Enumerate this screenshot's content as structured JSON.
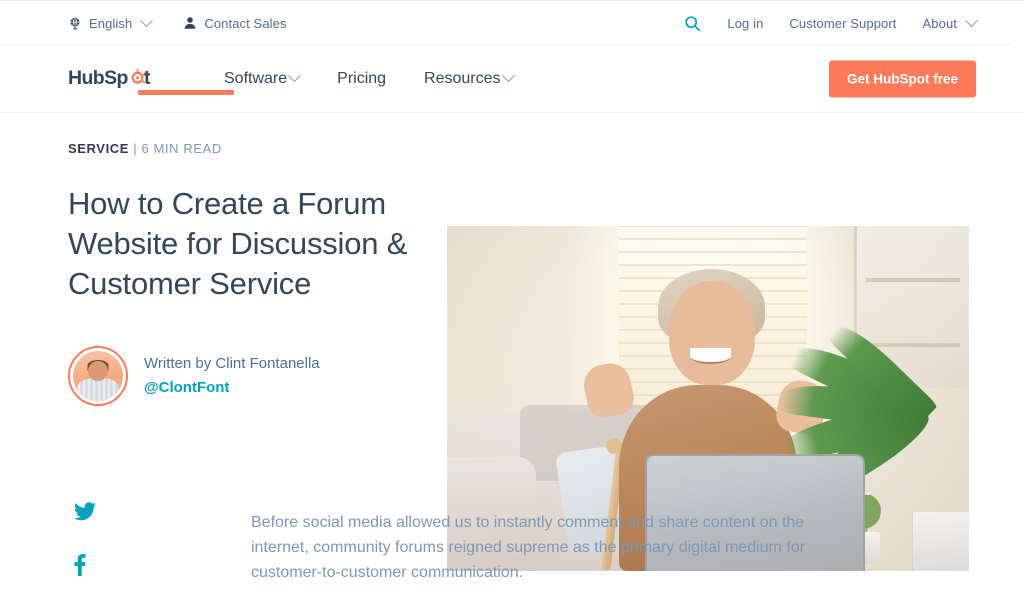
{
  "utility_bar": {
    "language": {
      "icon": "globe-icon",
      "label": "English",
      "chevron": "chevron-down-icon"
    },
    "contact": {
      "icon": "person-icon",
      "label": "Contact Sales"
    },
    "search": {
      "icon": "search-icon"
    },
    "login": {
      "label": "Log in"
    },
    "support": {
      "label": "Customer Support"
    },
    "about": {
      "label": "About",
      "chevron": "chevron-down-icon"
    }
  },
  "main_nav": {
    "logo": {
      "name": "hubspot-logo",
      "text_part1": "HubSp",
      "text_part2": "t"
    },
    "links": [
      {
        "label": "Software",
        "has_chevron": true
      },
      {
        "label": "Pricing",
        "has_chevron": false
      },
      {
        "label": "Resources",
        "has_chevron": true
      }
    ],
    "cta": {
      "label": "Get HubSpot free"
    }
  },
  "article": {
    "category": "SERVICE",
    "read_meta": "| 6 MIN READ",
    "headline": "How to Create a Forum Website for Discussion & Customer Service",
    "author": {
      "written_by": "Written by Clint Fontanella",
      "handle": "@ClontFont",
      "avatar_alt": "avatar"
    },
    "body_paragraph": "Before social media allowed us to instantly comment and share content on the internet, community forums reigned supreme as the primary digital medium for customer-to-customer communication."
  },
  "share": {
    "twitter": "twitter-icon",
    "facebook": "facebook-icon"
  },
  "colors": {
    "accent_orange": "#ff7a59",
    "accent_teal": "#00a4bd",
    "text_dark": "#33475b",
    "text_muted": "#7c98b6"
  }
}
